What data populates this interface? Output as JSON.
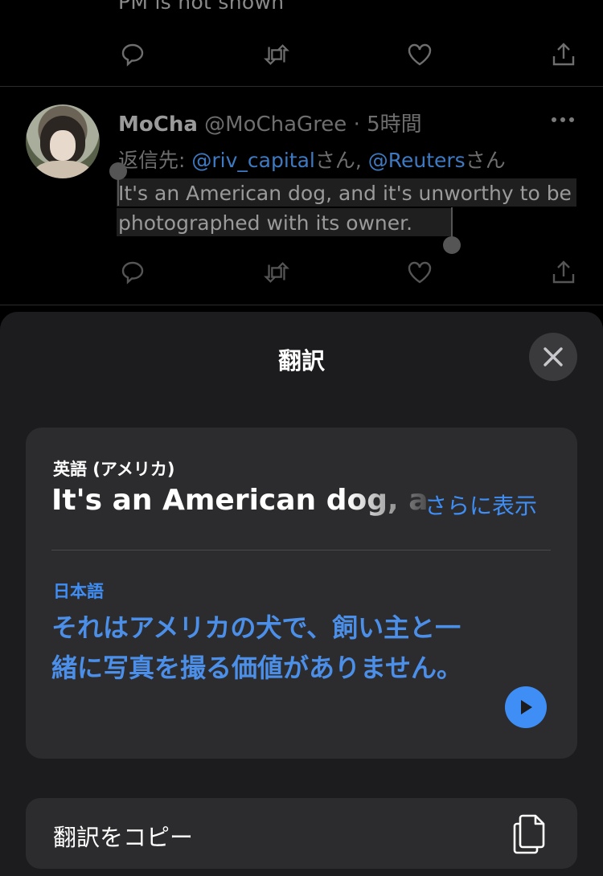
{
  "timeline": {
    "prev_tweet_text": "PM is not shown",
    "tweet": {
      "name": "MoCha",
      "handle": "@MoChaGree · 5時間",
      "reply_prefix": "返信先: ",
      "mention1": "@riv_capital",
      "san1": "さん, ",
      "mention2": "@Reuters",
      "san2": "さん",
      "body": "It's an American dog, and it's unworthy to be photographed with its owner."
    }
  },
  "sheet": {
    "title": "翻訳",
    "source_language": "英語 (アメリカ)",
    "source_text": "It's an American dog, and it's unworthy to be photographed with its owner.",
    "show_more": "さらに表示",
    "target_language": "日本語",
    "target_text": "それはアメリカの犬で、飼い主と一緒に写真を撮る価値がありません。",
    "copy_label": "翻訳をコピー"
  },
  "colors": {
    "accent": "#3f8ef5",
    "sheet_bg": "#1c1c1e",
    "card_bg": "#2c2c2e"
  }
}
